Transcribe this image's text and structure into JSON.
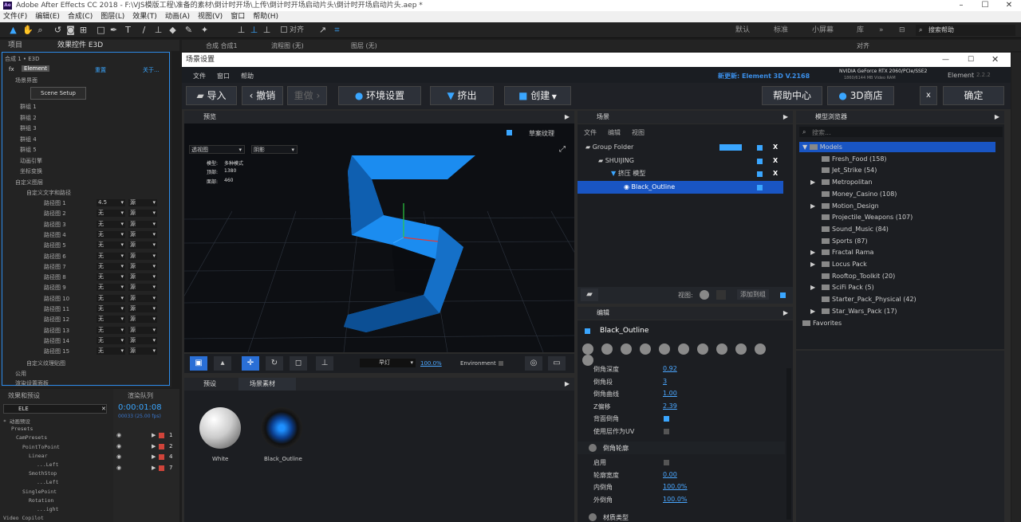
{
  "app": {
    "title": "Adobe After Effects CC 2018 - F:\\VJS模版工程\\准备的素材\\倒计时开场\\上传\\倒计时开场启动片头\\倒计时开场启动片头.aep *",
    "logo": "Ae"
  },
  "menu": [
    "文件(F)",
    "编辑(E)",
    "合成(C)",
    "图层(L)",
    "效果(T)",
    "动画(A)",
    "视图(V)",
    "窗口",
    "帮助(H)"
  ],
  "toolbar": {
    "align_label": "对齐",
    "workspaces": [
      "默认",
      "标准",
      "小屏幕",
      "库"
    ],
    "search_placeholder": "搜索帮助"
  },
  "left_panel": {
    "tabs": {
      "project": "项目",
      "effect_controls": "效果控件 E3D"
    },
    "breadcrumb": "合成 1 • E3D",
    "fx_row": {
      "fx": "fx",
      "name": "Element",
      "reset": "重置",
      "about": "关于..."
    },
    "scene_interface": "场景界面",
    "scene_setup_btn": "Scene Setup",
    "groups": [
      "群组 1",
      "群组 2",
      "群组 3",
      "群组 4",
      "群组 5",
      "动画引擎",
      "坐标变换"
    ],
    "custom_layers": "自定义图层",
    "custom_text": "自定义文字和路径",
    "path_layers": [
      {
        "label": "路径图 1",
        "value": "4.5",
        "src": "源"
      },
      {
        "label": "路径图 2",
        "value": "无",
        "src": "源"
      },
      {
        "label": "路径图 3",
        "value": "无",
        "src": "源"
      },
      {
        "label": "路径图 4",
        "value": "无",
        "src": "源"
      },
      {
        "label": "路径图 5",
        "value": "无",
        "src": "源"
      },
      {
        "label": "路径图 6",
        "value": "无",
        "src": "源"
      },
      {
        "label": "路径图 7",
        "value": "无",
        "src": "源"
      },
      {
        "label": "路径图 8",
        "value": "无",
        "src": "源"
      },
      {
        "label": "路径图 9",
        "value": "无",
        "src": "源"
      },
      {
        "label": "路径图 10",
        "value": "无",
        "src": "源"
      },
      {
        "label": "路径图 11",
        "value": "无",
        "src": "源"
      },
      {
        "label": "路径图 12",
        "value": "无",
        "src": "源"
      },
      {
        "label": "路径图 13",
        "value": "无",
        "src": "源"
      },
      {
        "label": "路径图 14",
        "value": "无",
        "src": "源"
      },
      {
        "label": "路径图 15",
        "value": "无",
        "src": "源"
      }
    ],
    "custom_texture": "自定义纹理贴图",
    "public": "公用",
    "render_settings": "渲染设置面板"
  },
  "effects_panel": {
    "tab": "效果和预设",
    "search_value": "ELE",
    "tree": [
      "* 动画预设",
      "Presets",
      "CamPresets",
      "PointToPoint",
      "Linear",
      "...Left",
      "SmothStop",
      "...Left",
      "SinglePoint",
      "Rotation",
      "...ight",
      "Video Copilot"
    ]
  },
  "render_queue": {
    "tab": "渲染队列",
    "timecode": "0:00:01:08",
    "frames": "00033 (25.00 fps)",
    "layers": [
      "1",
      "2",
      "4",
      "7"
    ]
  },
  "comp_tabs": {
    "comp": "合成 合成1",
    "flow": "流程图 (无)",
    "layer": "图层 (无)",
    "align": "对齐"
  },
  "dialog": {
    "title": "场景设置",
    "menu": [
      "文件",
      "窗口",
      "帮助"
    ],
    "update": "新更新: Element 3D V.2168",
    "gpu": "NVIDIA GeForce RTX 2060/PCIe/SSE2",
    "vram": "1860/6144 MB Video RAM",
    "version_label": "Element",
    "version": "2.2.2",
    "buttons": {
      "import": "导入",
      "undo": "撤销",
      "redo": "重做",
      "env": "环境设置",
      "extrude": "挤出",
      "create": "创建",
      "help": "帮助中心",
      "store": "3D商店",
      "close": "x",
      "ok": "确定"
    },
    "preview": {
      "head": "预览",
      "draft": "草案纹理",
      "view_mode": "透视图",
      "shadow": "阴影",
      "stats": [
        [
          "模型:",
          "多种模式"
        ],
        [
          "顶部:",
          "1380"
        ],
        [
          "面部:",
          "460"
        ]
      ],
      "light": "早灯",
      "zoom": "100.0%",
      "env": "Environment"
    },
    "presets": {
      "tabs": [
        "预设",
        "场景素材"
      ],
      "materials": [
        "White",
        "Black_Outline"
      ]
    },
    "scene": {
      "head": "场景",
      "menu": [
        "文件",
        "编辑",
        "视图"
      ],
      "items": [
        {
          "name": "Group Folder",
          "level": 0
        },
        {
          "name": "SHUIJING",
          "level": 1
        },
        {
          "name": "挤压 模型",
          "level": 2
        },
        {
          "name": "Black_Outline",
          "level": 3
        }
      ],
      "view": "视图:",
      "add": "添加到组"
    },
    "edit": {
      "head": "编辑",
      "material": "Black_Outline",
      "props": [
        [
          "倒角深度",
          "0.92"
        ],
        [
          "倒角段",
          "3"
        ],
        [
          "倒角曲线",
          "1.00"
        ],
        [
          "Z偏移",
          "2.39"
        ],
        [
          "背面倒角",
          ""
        ],
        [
          "使用层作为UV",
          ""
        ]
      ],
      "bevel_head": "倒角轮廓",
      "bevel": [
        [
          "启用",
          ""
        ],
        [
          "轮廓宽度",
          "0.00"
        ],
        [
          "内倒角",
          "100.0%"
        ],
        [
          "外倒角",
          "100.0%"
        ]
      ],
      "material_type": "材质类型"
    },
    "browser": {
      "head": "模型浏览器",
      "search": "搜索...",
      "items": [
        "Models",
        "Fresh_Food (158)",
        "Jet_Strike (54)",
        "Metropolitan",
        "Money_Casino (108)",
        "Motion_Design",
        "Projectile_Weapons (107)",
        "Sound_Music (84)",
        "Sports (87)",
        "Fractal Rama",
        "Locus Pack",
        "Rooftop_Toolkit (20)",
        "SciFi Pack (5)",
        "Starter_Pack_Physical (42)",
        "Star_Wars_Pack (17)",
        "Favorites"
      ]
    }
  },
  "colors": {
    "accent": "#2d8ceb",
    "selection": "#1955c3",
    "model": "#1b8cf0"
  }
}
